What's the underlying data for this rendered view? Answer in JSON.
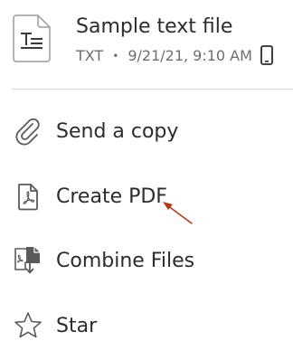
{
  "file": {
    "name": "Sample text file",
    "type": "TXT",
    "separator": "•",
    "date": "9/21/21, 9:10 AM",
    "icon": "text-file-icon",
    "location_icon": "mobile-device-icon"
  },
  "menu": {
    "items": [
      {
        "label": "Send a copy",
        "icon": "paperclip-icon"
      },
      {
        "label": "Create PDF",
        "icon": "pdf-file-icon"
      },
      {
        "label": "Combine Files",
        "icon": "combine-files-icon"
      },
      {
        "label": "Star",
        "icon": "star-icon"
      }
    ]
  },
  "colors": {
    "text": "#2c2c2c",
    "secondary_text": "#6e6e6e",
    "divider": "#d8d8d8",
    "annotation_arrow": "#b03a1a"
  }
}
